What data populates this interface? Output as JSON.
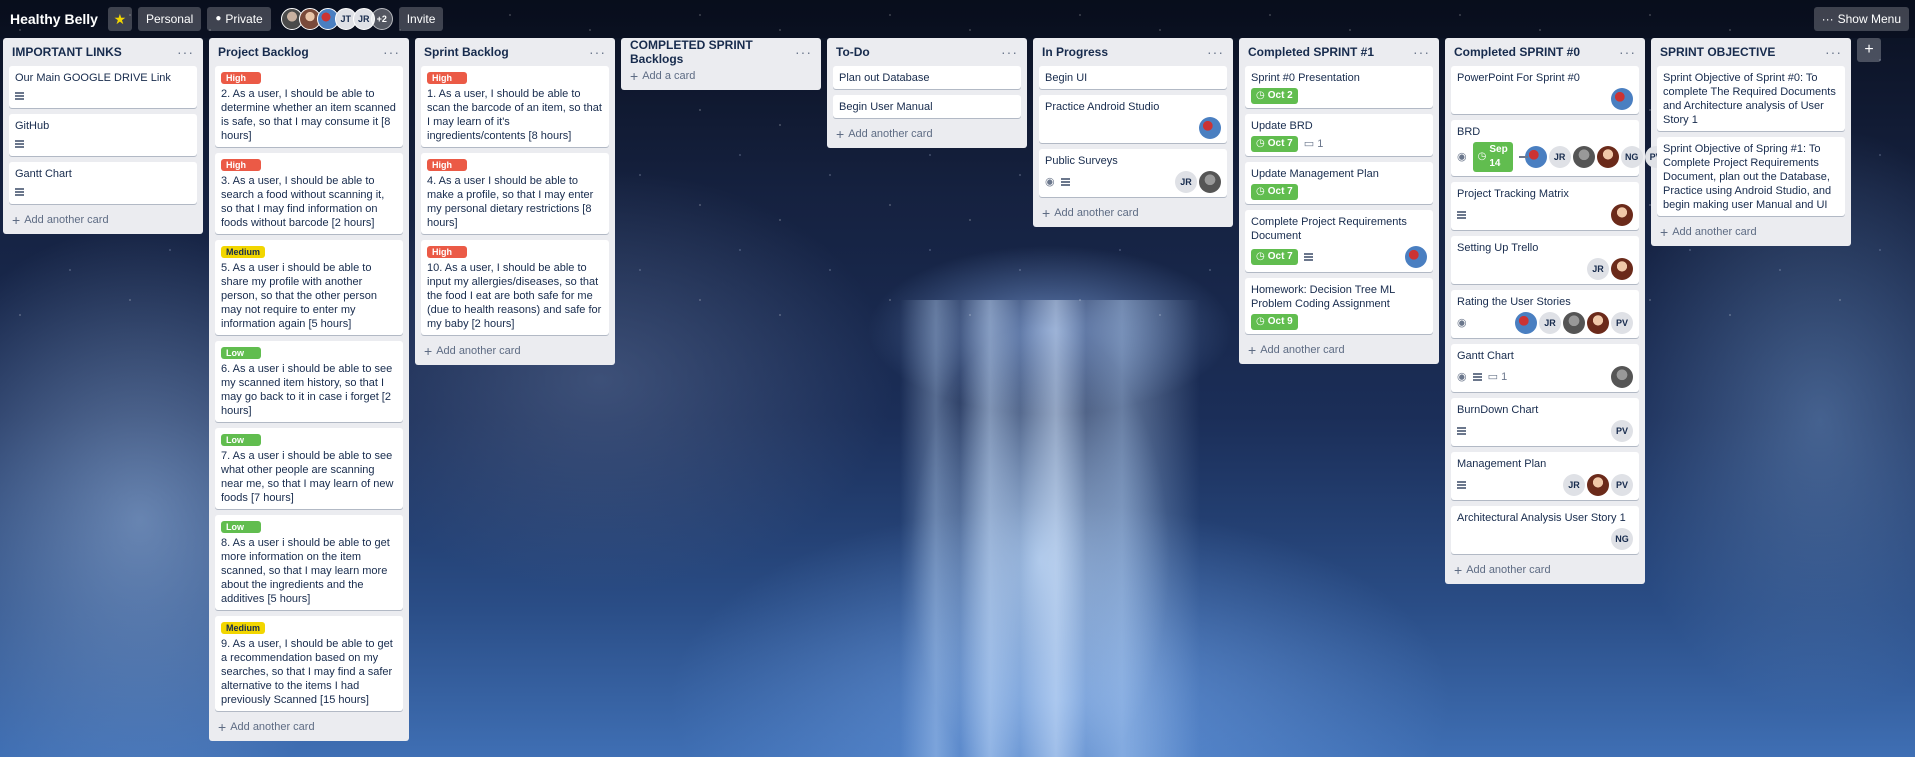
{
  "header": {
    "title": "Healthy Belly",
    "personal": "Personal",
    "private": "Private",
    "members": [
      {
        "initials": "",
        "style": "av-photo1"
      },
      {
        "initials": "",
        "style": "av-photo2"
      },
      {
        "initials": "",
        "style": "av-photo3"
      },
      {
        "initials": "JT",
        "style": ""
      },
      {
        "initials": "JR",
        "style": ""
      }
    ],
    "more_members": "+2",
    "invite": "Invite",
    "show_menu": "Show Menu"
  },
  "lists": [
    {
      "title": "IMPORTANT LINKS",
      "add_text": "Add another card",
      "cards": [
        {
          "text": "Our Main GOOGLE DRIVE Link",
          "desc": true
        },
        {
          "text": "GitHub",
          "desc": true
        },
        {
          "text": "Gantt Chart",
          "desc": true
        }
      ]
    },
    {
      "title": "Project Backlog",
      "add_text": "Add another card",
      "cards": [
        {
          "label": "High",
          "label_type": "high",
          "text": "2. As a user, I should be able to determine whether an item scanned is safe, so that I may consume it [8 hours]"
        },
        {
          "label": "High",
          "label_type": "high",
          "text": "3. As a user, I should be able to search a food without scanning it, so that I may find information on foods without barcode [2 hours]"
        },
        {
          "label": "Medium",
          "label_type": "medium",
          "text": "5. As a user i should be able to share my profile with another person, so that the other person may not require to enter my information again [5 hours]"
        },
        {
          "label": "Low",
          "label_type": "low",
          "text": "6. As a user i should be able to see my scanned item history, so that I may go back to it in case i forget [2 hours]"
        },
        {
          "label": "Low",
          "label_type": "low",
          "text": "7. As a user i should be able to see what other people are scanning near me, so that I may learn of new foods [7 hours]"
        },
        {
          "label": "Low",
          "label_type": "low",
          "text": "8. As a user i should be able to get more information on the item scanned, so that I may learn more about the ingredients and the additives [5 hours]"
        },
        {
          "label": "Medium",
          "label_type": "medium",
          "text": "9. As a user, I should be able to get a recommendation based on my searches, so that I may find a safer alternative to the items I had previously Scanned [15 hours]"
        }
      ]
    },
    {
      "title": "Sprint Backlog",
      "add_text": "Add another card",
      "cards": [
        {
          "label": "High",
          "label_type": "high",
          "text": "1. As a user, I should be able to scan the barcode of an item, so that I may learn of it's ingredients/contents [8 hours]"
        },
        {
          "label": "High",
          "label_type": "high",
          "text": "4. As a user I should be able to make a profile, so that I may enter my personal dietary restrictions [8 hours]"
        },
        {
          "label": "High",
          "label_type": "high",
          "text": "10. As a user, I should be able to input my allergies/diseases, so that the food I eat are both safe for me (due to health reasons) and safe for my baby [2 hours]"
        }
      ]
    },
    {
      "title": "COMPLETED SPRINT Backlogs",
      "add_text": "Add a card",
      "cards": []
    },
    {
      "title": "To-Do",
      "add_text": "Add another card",
      "cards": [
        {
          "text": "Plan out Database"
        },
        {
          "text": "Begin User Manual"
        }
      ]
    },
    {
      "title": "In Progress",
      "add_text": "Add another card",
      "cards": [
        {
          "text": "Begin UI"
        },
        {
          "text": "Practice Android Studio",
          "members": [
            {
              "initials": "",
              "style": "av-photo3"
            }
          ]
        },
        {
          "text": "Public Surveys",
          "watch": true,
          "desc": true,
          "members": [
            {
              "initials": "JR",
              "style": ""
            },
            {
              "initials": "",
              "style": "av-photo4"
            }
          ]
        }
      ]
    },
    {
      "title": "Completed SPRINT #1",
      "add_text": "Add another card",
      "cards": [
        {
          "text": "Sprint #0 Presentation",
          "due": "Oct 2"
        },
        {
          "text": "Update BRD",
          "due": "Oct 7",
          "comments": "1"
        },
        {
          "text": "Update Management Plan",
          "due": "Oct 7"
        },
        {
          "text": "Complete Project Requirements Document",
          "due": "Oct 7",
          "desc": true,
          "members": [
            {
              "initials": "",
              "style": "av-photo3"
            }
          ]
        },
        {
          "text": "Homework: Decision Tree ML Problem Coding Assignment",
          "due": "Oct 9"
        }
      ]
    },
    {
      "title": "Completed SPRINT #0",
      "add_text": "Add another card",
      "cards": [
        {
          "text": "PowerPoint For Sprint #0",
          "members": [
            {
              "initials": "",
              "style": "av-photo3"
            }
          ]
        },
        {
          "text": "BRD",
          "watch": true,
          "due": "Sep 14",
          "desc": true,
          "members": [
            {
              "initials": "",
              "style": "av-photo3"
            },
            {
              "initials": "JR",
              "style": ""
            },
            {
              "initials": "",
              "style": "av-photo4"
            },
            {
              "initials": "",
              "style": "av-photo5"
            },
            {
              "initials": "NG",
              "style": ""
            },
            {
              "initials": "PV",
              "style": ""
            }
          ]
        },
        {
          "text": "Project Tracking Matrix",
          "desc": true,
          "members": [
            {
              "initials": "",
              "style": "av-photo5"
            }
          ]
        },
        {
          "text": "Setting Up Trello",
          "members": [
            {
              "initials": "JR",
              "style": ""
            },
            {
              "initials": "",
              "style": "av-photo5"
            }
          ]
        },
        {
          "text": "Rating the User Stories",
          "watch": true,
          "members": [
            {
              "initials": "",
              "style": "av-photo3"
            },
            {
              "initials": "JR",
              "style": ""
            },
            {
              "initials": "",
              "style": "av-photo4"
            },
            {
              "initials": "",
              "style": "av-photo5"
            },
            {
              "initials": "PV",
              "style": ""
            }
          ]
        },
        {
          "text": "Gantt Chart",
          "watch": true,
          "desc": true,
          "comments": "1",
          "members": [
            {
              "initials": "",
              "style": "av-photo4"
            }
          ]
        },
        {
          "text": "BurnDown Chart",
          "desc": true,
          "members": [
            {
              "initials": "PV",
              "style": ""
            }
          ]
        },
        {
          "text": "Management Plan",
          "desc": true,
          "members": [
            {
              "initials": "JR",
              "style": ""
            },
            {
              "initials": "",
              "style": "av-photo5"
            },
            {
              "initials": "PV",
              "style": ""
            }
          ]
        },
        {
          "text": "Architectural Analysis User Story 1",
          "members": [
            {
              "initials": "NG",
              "style": ""
            }
          ]
        }
      ]
    },
    {
      "title": "SPRINT OBJECTIVE",
      "add_text": "Add another card",
      "cards": [
        {
          "text": "Sprint Objective of Sprint #0: To complete The Required Documents and Architecture analysis of User Story 1"
        },
        {
          "text": "Sprint Objective of Spring #1: To Complete Project Requirements Document, plan out the Database, Practice using Android Studio, and begin making user Manual and UI"
        }
      ]
    }
  ],
  "icons": {
    "star": "★",
    "lock": "🔒",
    "menu_dots": "···",
    "plus": "+",
    "clock": "◷",
    "eye": "👁",
    "comment": "💬"
  }
}
